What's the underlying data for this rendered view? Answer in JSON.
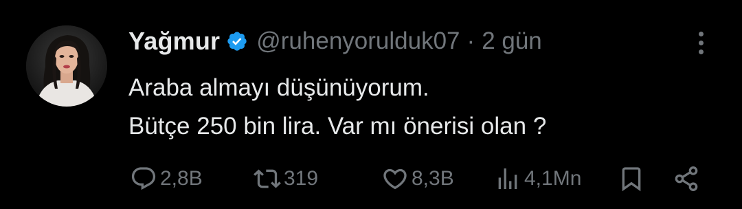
{
  "tweet": {
    "author": {
      "display_name": "Yağmur",
      "verified": true,
      "handle": "@ruhenyorulduk07",
      "avatar_icon": "profile-photo"
    },
    "separator": "·",
    "timestamp": "2 gün",
    "text_lines": [
      "Araba almayı düşünüyorum.",
      "Bütçe 250 bin lira. Var mı önerisi olan ?"
    ],
    "actions": {
      "reply": {
        "icon": "reply-icon",
        "count": "2,8B"
      },
      "retweet": {
        "icon": "retweet-icon",
        "count": "319"
      },
      "like": {
        "icon": "heart-icon",
        "count": "8,3B"
      },
      "views": {
        "icon": "views-icon",
        "count": "4,1Mn"
      },
      "bookmark": {
        "icon": "bookmark-icon"
      },
      "share": {
        "icon": "share-icon"
      }
    },
    "more_icon": "more-dots-icon"
  },
  "colors": {
    "background": "#000000",
    "primary_text": "#e7e9ea",
    "secondary_text": "#71767b",
    "verified_blue": "#1d9bf0"
  }
}
